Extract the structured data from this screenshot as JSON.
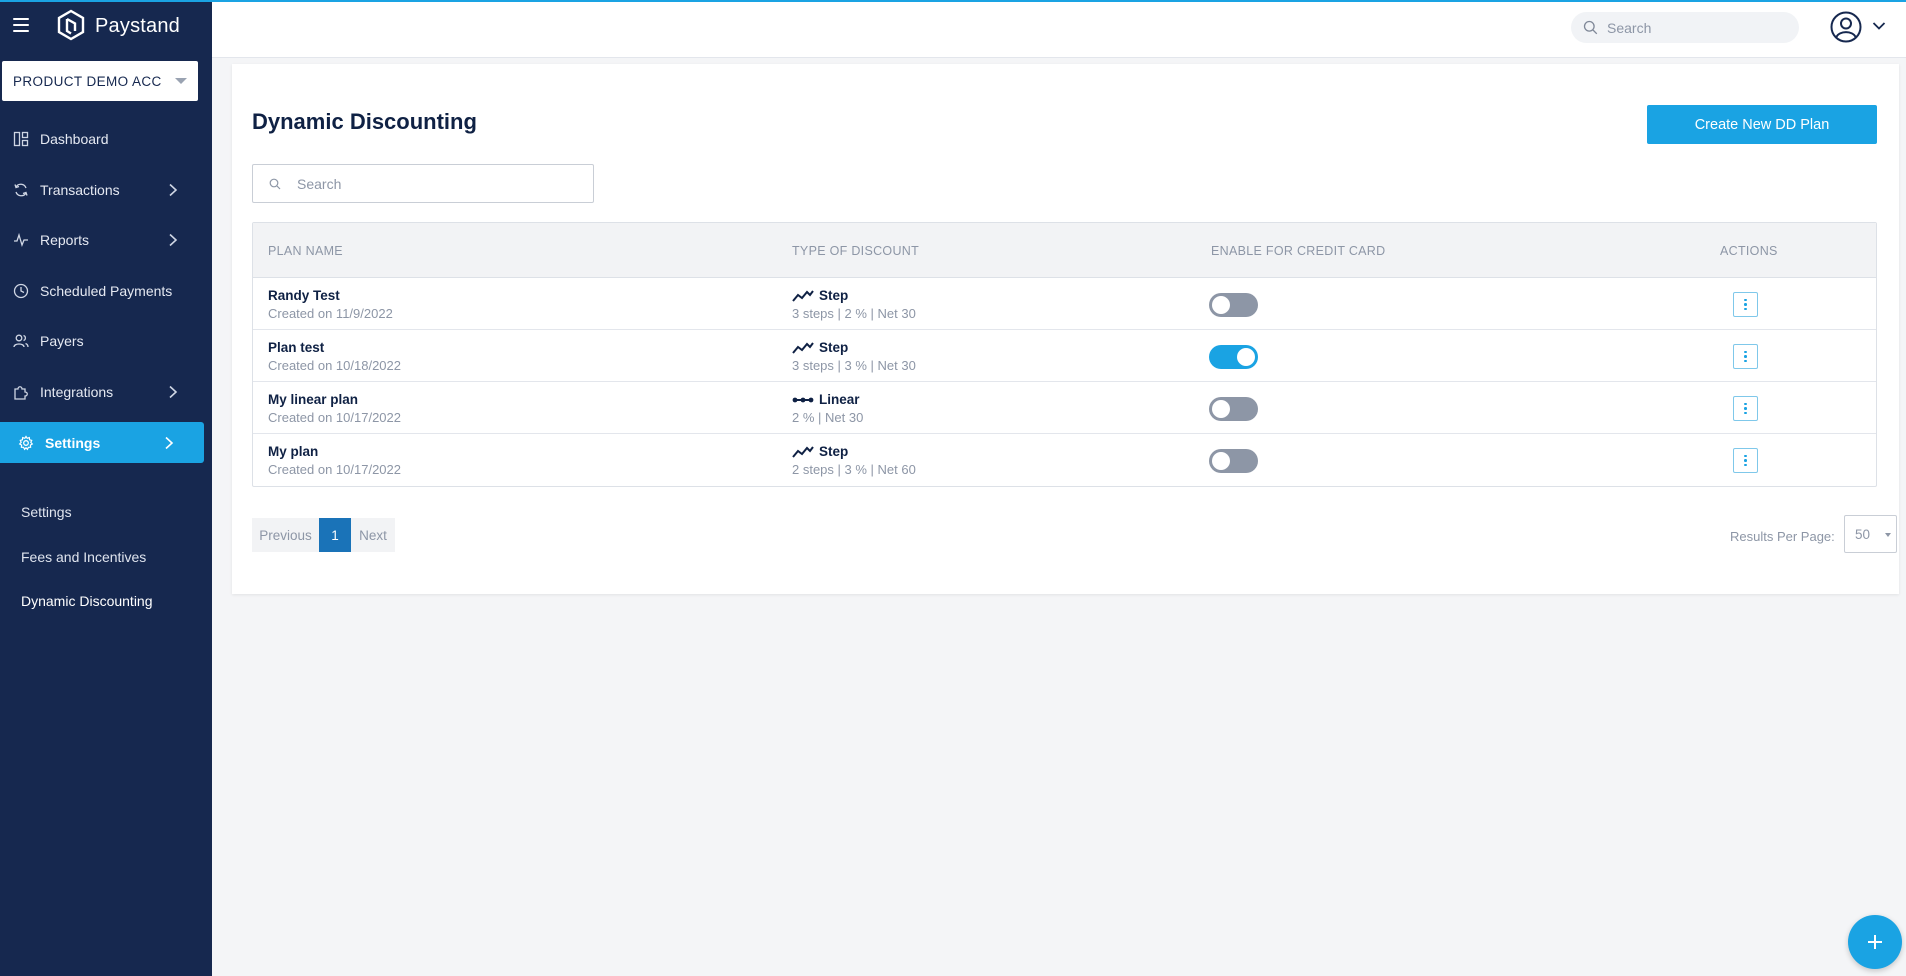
{
  "brand": {
    "name": "Paystand"
  },
  "account": {
    "label": "PRODUCT DEMO ACC"
  },
  "sidebar": {
    "items": [
      {
        "label": "Dashboard",
        "icon": "dashboard-icon"
      },
      {
        "label": "Transactions",
        "icon": "transactions-icon"
      },
      {
        "label": "Reports",
        "icon": "reports-icon"
      },
      {
        "label": "Scheduled Payments",
        "icon": "clock-icon"
      },
      {
        "label": "Payers",
        "icon": "payers-icon"
      },
      {
        "label": "Integrations",
        "icon": "puzzle-icon"
      },
      {
        "label": "Settings",
        "icon": "gear-icon",
        "active": true
      }
    ],
    "subitems": [
      {
        "label": "Settings"
      },
      {
        "label": "Fees and Incentives"
      },
      {
        "label": "Dynamic Discounting",
        "current": true
      }
    ]
  },
  "topbar": {
    "search_placeholder": "Search"
  },
  "page": {
    "title": "Dynamic Discounting",
    "create_button": "Create New DD Plan",
    "search_placeholder": "Search"
  },
  "table": {
    "headers": [
      "PLAN NAME",
      "TYPE OF DISCOUNT",
      "ENABLE FOR CREDIT CARD",
      "ACTIONS"
    ],
    "rows": [
      {
        "name": "Randy Test",
        "created": "Created on 11/9/2022",
        "type": "Step",
        "type_icon": "step-chart-icon",
        "detail": "3 steps | 2 % | Net 30",
        "credit_card_enabled": false
      },
      {
        "name": "Plan test",
        "created": "Created on 10/18/2022",
        "type": "Step",
        "type_icon": "step-chart-icon",
        "detail": "3 steps | 3 % | Net 30",
        "credit_card_enabled": true
      },
      {
        "name": "My linear plan",
        "created": "Created on 10/17/2022",
        "type": "Linear",
        "type_icon": "linear-chart-icon",
        "detail": "2 % | Net 30",
        "credit_card_enabled": false
      },
      {
        "name": "My plan",
        "created": "Created on 10/17/2022",
        "type": "Step",
        "type_icon": "step-chart-icon",
        "detail": "2 steps | 3 % | Net 60",
        "credit_card_enabled": false
      }
    ]
  },
  "pagination": {
    "previous": "Previous",
    "current_page": "1",
    "next": "Next"
  },
  "results_per_page": {
    "label": "Results Per Page:",
    "value": "50"
  },
  "colors": {
    "sidebar": "#16284f",
    "accent": "#1aa3e3",
    "page_active": "#1a73b8"
  }
}
